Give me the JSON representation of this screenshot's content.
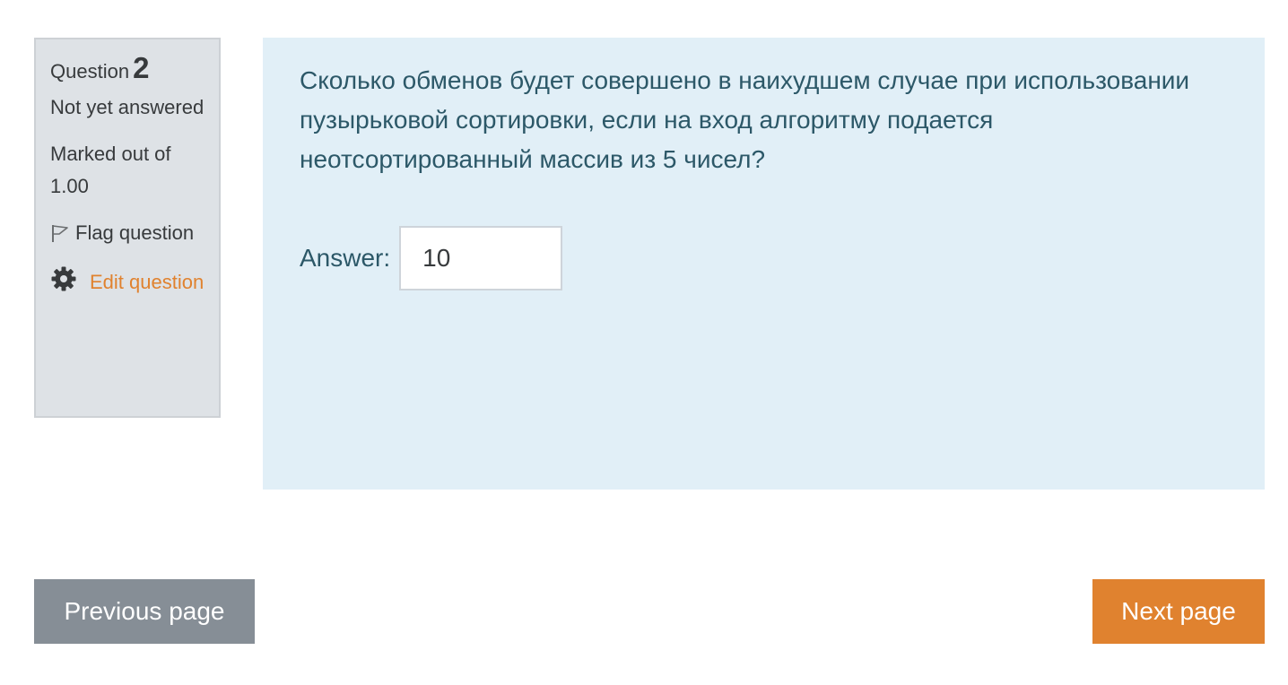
{
  "question_info": {
    "label": "Question",
    "number": "2",
    "state": "Not yet answered",
    "grade": "Marked out of 1.00",
    "flag_label": "Flag question",
    "edit_label": "Edit question",
    "icons": {
      "flag": "flag-icon",
      "edit": "gear-icon"
    }
  },
  "question": {
    "text": "Сколько обменов будет совершено в наихудшем случае при использовании пузырьковой сортировки, если на вход алгоритму подается неотсортированный массив из 5 чисел?",
    "answer_label": "Answer:",
    "answer_value": "10"
  },
  "navigation": {
    "previous_label": "Previous page",
    "next_label": "Next page"
  },
  "colors": {
    "info_background": "#dee2e6",
    "content_background": "#e1eff7",
    "text_primary": "#2c5868",
    "accent": "#e0822f",
    "secondary_button": "#868e96"
  }
}
